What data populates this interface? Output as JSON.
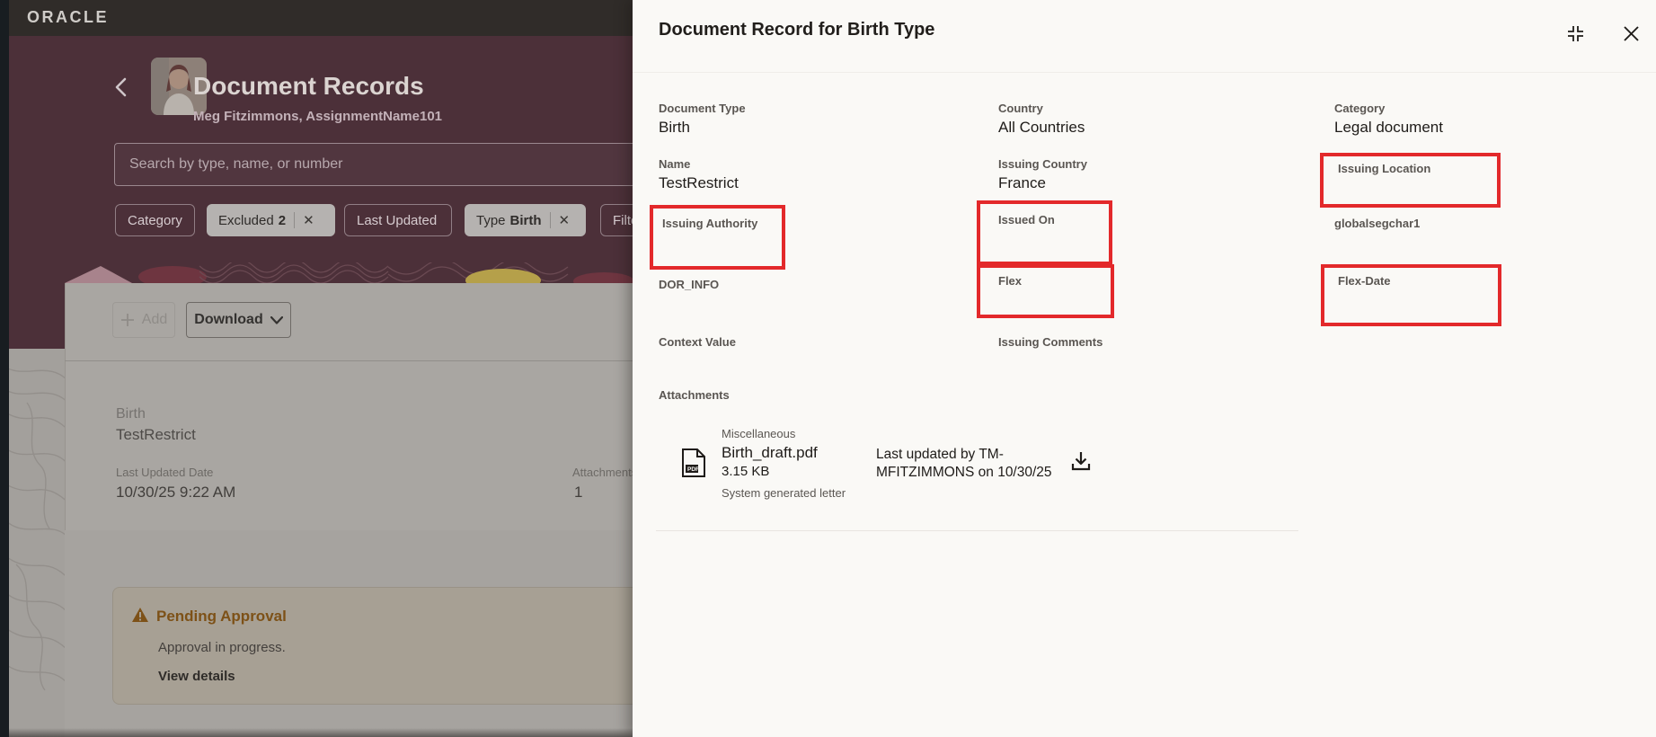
{
  "topbar": {
    "logo": "ORACLE"
  },
  "hero": {
    "title": "Document Records",
    "subtitle": "Meg Fitzimmons, AssignmentName101",
    "search_placeholder": "Search by type, name, or number",
    "chips": [
      {
        "label": "Category"
      },
      {
        "label": "Excluded",
        "count": "2"
      },
      {
        "label": "Last Updated"
      },
      {
        "label": "Type",
        "value": "Birth"
      },
      {
        "label": "Filte"
      }
    ]
  },
  "toolbar": {
    "add_label": "Add",
    "download_label": "Download"
  },
  "record_card": {
    "type": "Birth",
    "name": "TestRestrict",
    "last_updated_label": "Last Updated Date",
    "last_updated": "10/30/25 9:22 AM",
    "attachments_label": "Attachments",
    "attachments_count": "1"
  },
  "banner": {
    "title": "Pending Approval",
    "message": "Approval in progress.",
    "action": "View details"
  },
  "panel": {
    "title": "Document Record for Birth Type",
    "fields": {
      "document_type_label": "Document Type",
      "document_type": "Birth",
      "country_label": "Country",
      "country": "All Countries",
      "category_label": "Category",
      "category": "Legal document",
      "name_label": "Name",
      "name": "TestRestrict",
      "issuing_country_label": "Issuing Country",
      "issuing_country": "France",
      "issuing_location_label": "Issuing Location",
      "issuing_authority_label": "Issuing Authority",
      "issued_on_label": "Issued On",
      "globalsegchar1_label": "globalsegchar1",
      "dor_info_label": "DOR_INFO",
      "flex_label": "Flex",
      "flex_date_label": "Flex-Date",
      "context_value_label": "Context Value",
      "issuing_comments_label": "Issuing Comments"
    },
    "attachments": {
      "section_label": "Attachments",
      "items": [
        {
          "category": "Miscellaneous",
          "filename": "Birth_draft.pdf",
          "size": "3.15 KB",
          "description": "System generated letter",
          "last_updated": "Last updated by TM-MFITZIMMONS on 10/30/25"
        }
      ]
    }
  },
  "colors": {
    "annotation_red": "#e3292b",
    "hero_maroon": "#4c3039",
    "topbar_dark": "#302c29",
    "warning_brown": "#7d5117",
    "panel_bg": "#faf9f6"
  }
}
